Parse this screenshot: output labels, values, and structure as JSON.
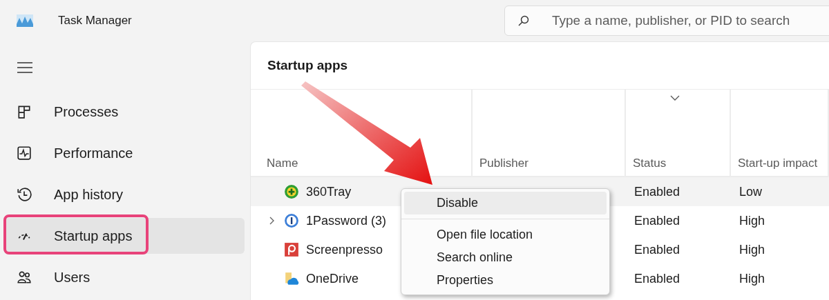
{
  "window": {
    "title": "Task Manager"
  },
  "search": {
    "placeholder": "Type a name, publisher, or PID to search"
  },
  "nav": [
    {
      "label": "Processes",
      "selected": false,
      "outlined": false
    },
    {
      "label": "Performance",
      "selected": false,
      "outlined": false
    },
    {
      "label": "App history",
      "selected": false,
      "outlined": false
    },
    {
      "label": "Startup apps",
      "selected": true,
      "outlined": true
    },
    {
      "label": "Users",
      "selected": false,
      "outlined": false
    }
  ],
  "page_title": "Startup apps",
  "columns": [
    {
      "label": "Name",
      "sorted": false
    },
    {
      "label": "Publisher",
      "sorted": false
    },
    {
      "label": "Status",
      "sorted": true
    },
    {
      "label": "Start-up impact",
      "sorted": false
    }
  ],
  "rows": [
    {
      "name": "360Tray",
      "status": "Enabled",
      "impact": "Low",
      "expandable": false,
      "selected": true
    },
    {
      "name": "1Password (3)",
      "status": "Enabled",
      "impact": "High",
      "expandable": true,
      "selected": false
    },
    {
      "name": "Screenpresso",
      "status": "Enabled",
      "impact": "High",
      "expandable": false,
      "selected": false
    },
    {
      "name": "OneDrive",
      "status": "Enabled",
      "impact": "High",
      "expandable": false,
      "selected": false
    }
  ],
  "context_menu": [
    {
      "kind": "item",
      "label": "Disable",
      "highlighted": true
    },
    {
      "kind": "separator"
    },
    {
      "kind": "item",
      "label": "Open file location",
      "highlighted": false
    },
    {
      "kind": "item",
      "label": "Search online",
      "highlighted": false
    },
    {
      "kind": "item",
      "label": "Properties",
      "highlighted": false
    }
  ],
  "annotations": [
    {
      "kind": "arrow"
    }
  ]
}
